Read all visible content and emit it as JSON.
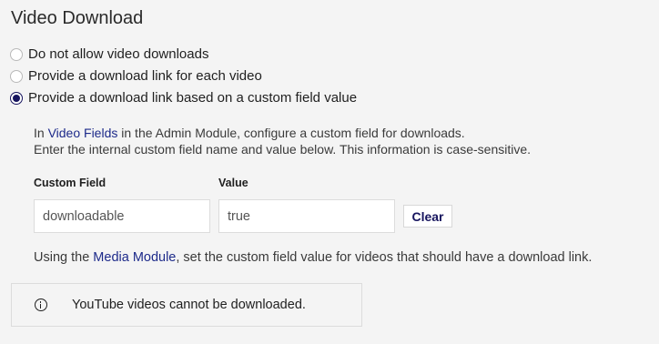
{
  "section": {
    "title": "Video Download"
  },
  "options": [
    {
      "label": "Do not allow video downloads",
      "checked": false
    },
    {
      "label": "Provide a download link for each video",
      "checked": false
    },
    {
      "label": "Provide a download link based on a custom field value",
      "checked": true
    }
  ],
  "help": {
    "line1_prefix": "In ",
    "line1_link": "Video Fields",
    "line1_suffix": " in the Admin Module, configure a custom field for downloads.",
    "line2": "Enter the internal custom field name and value below. This information is case-sensitive."
  },
  "fields": {
    "custom_field_label": "Custom Field",
    "custom_field_value": "downloadable",
    "value_label": "Value",
    "value_value": "true",
    "clear_label": "Clear"
  },
  "media_note": {
    "prefix": "Using the ",
    "link": "Media Module",
    "suffix": ", set the custom field value for videos that should have a download link."
  },
  "notice": {
    "icon": "info-icon",
    "text": "YouTube videos cannot be downloaded."
  }
}
